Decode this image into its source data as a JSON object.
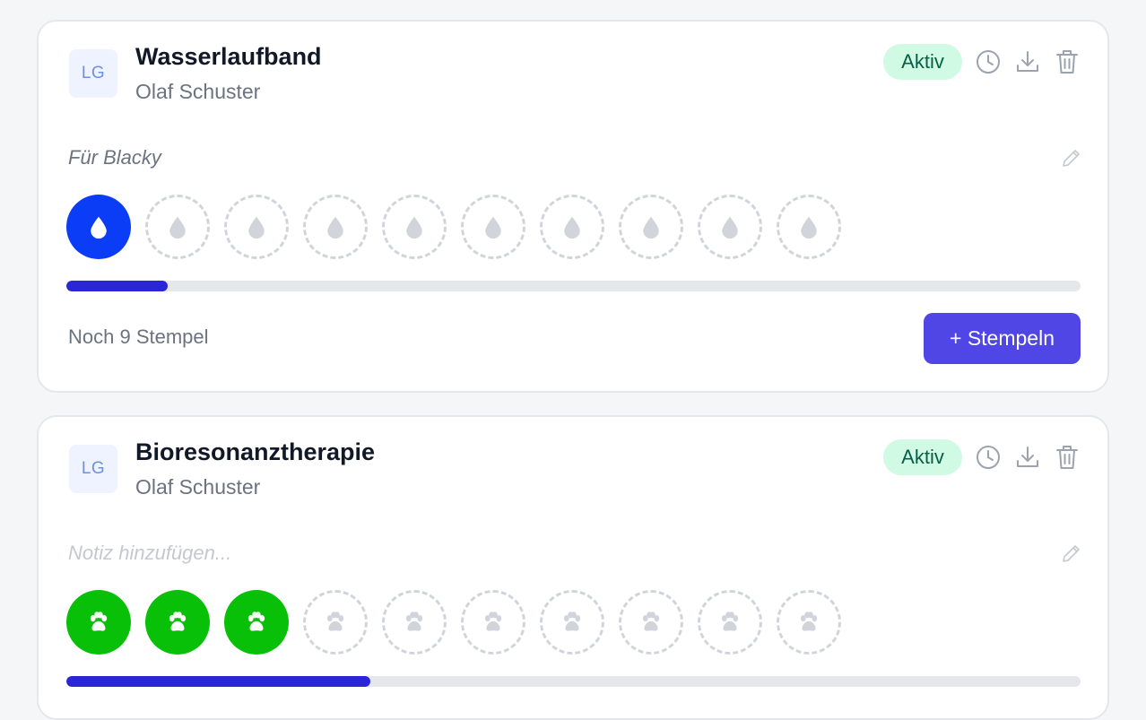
{
  "cards": [
    {
      "logo_text": "LG",
      "title": "Wasserlaufband",
      "subtitle": "Olaf Schuster",
      "status": "Aktiv",
      "note": "Für Blacky",
      "note_is_placeholder": false,
      "stamp_icon": "water-drop-icon",
      "stamp_color": "#0a3df5",
      "stamps_filled": 1,
      "stamps_total": 10,
      "progress": 0.1,
      "remaining": "Noch 9 Stempel",
      "action_label": "+ Stempeln"
    },
    {
      "logo_text": "LG",
      "title": "Bioresonanztherapie",
      "subtitle": "Olaf Schuster",
      "status": "Aktiv",
      "note": "Notiz hinzufügen...",
      "note_is_placeholder": true,
      "stamp_icon": "paw-icon",
      "stamp_color": "#08c008",
      "stamps_filled": 3,
      "stamps_total": 10,
      "progress": 0.3
    }
  ],
  "colors": {
    "badge_bg": "#d1fae5",
    "badge_text": "#065f46",
    "progress_fill": "#2a25d6",
    "button_bg": "#4f46e5",
    "empty_stamp_icon": "#d1d5db"
  }
}
